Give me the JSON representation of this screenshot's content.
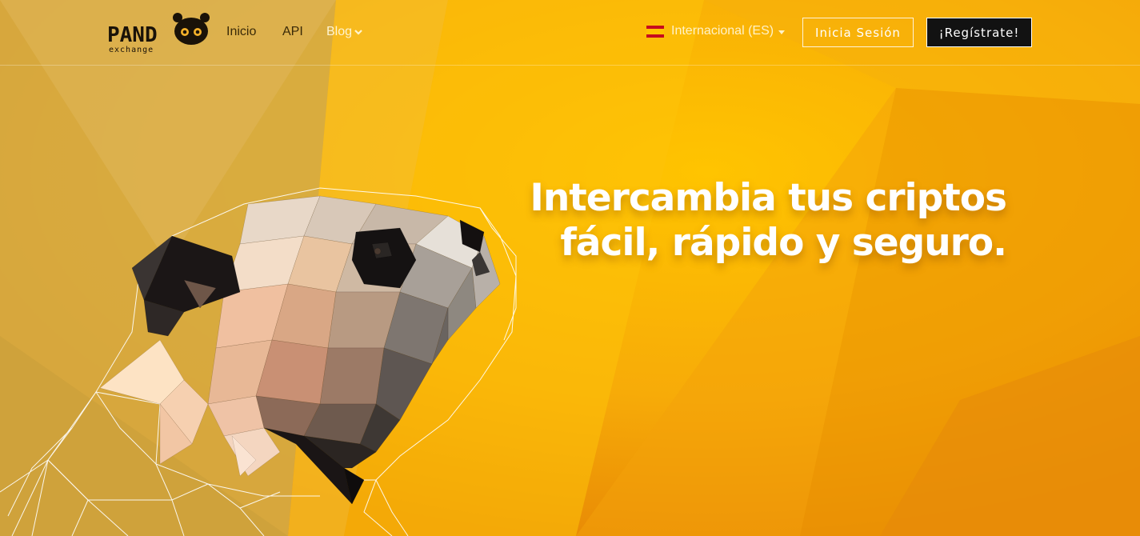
{
  "brand": {
    "logo_word": "PANDA",
    "logo_sub": "exchange"
  },
  "nav": {
    "items": [
      {
        "label": "Inicio"
      },
      {
        "label": "API"
      },
      {
        "label": "Blog"
      }
    ]
  },
  "language": {
    "label": "Internacional (ES)",
    "flag_icon": "spain-flag-icon"
  },
  "auth": {
    "login_label": "Inicia Sesión",
    "register_label": "¡Regístrate!"
  },
  "hero": {
    "line1": "Intercambia tus criptos",
    "line2": "fácil, rápido y seguro."
  },
  "colors": {
    "accent": "#f5a300",
    "light": "#ffc200",
    "dark_button": "#121212"
  }
}
